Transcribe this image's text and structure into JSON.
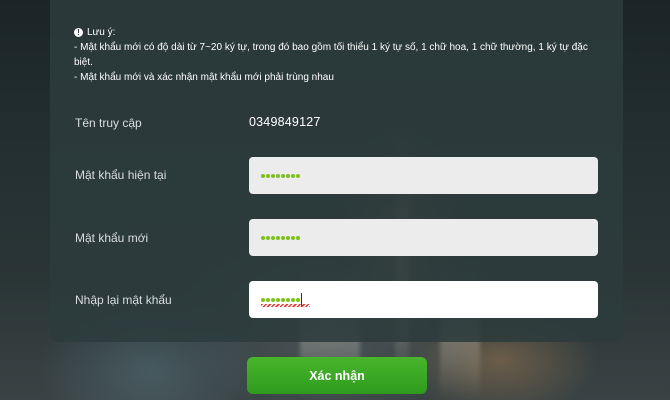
{
  "note": {
    "title": "Lưu ý:",
    "line1": "- Mật khẩu mới có độ dài từ 7~20 ký tự, trong đó bao gồm tối thiểu 1 ký tự số, 1 chữ hoa, 1 chữ thường, 1 ký tự đặc biệt.",
    "line2": "- Mật khẩu mới và xác nhận mật khẩu mới phải trùng nhau"
  },
  "form": {
    "username_label": "Tên truy cập",
    "username_value": "0349849127",
    "current_password_label": "Mật khẩu hiện tại",
    "current_password_dots": 8,
    "new_password_label": "Mật khẩu mới",
    "new_password_dots": 8,
    "confirm_password_label": "Nhập lại mật khẩu",
    "confirm_password_dots": 8
  },
  "submit_label": "Xác nhận",
  "colors": {
    "accent_green": "#7cc21b",
    "button_green": "#3aa824",
    "card_bg": "#2c3b3c"
  }
}
